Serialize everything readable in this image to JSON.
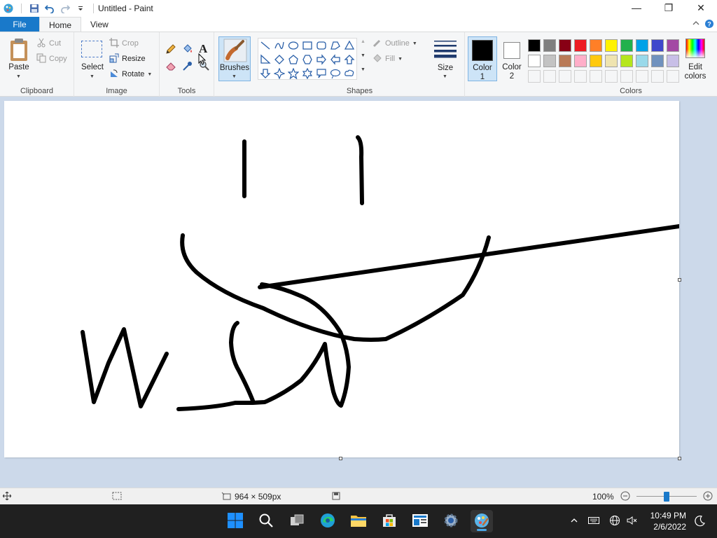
{
  "window": {
    "title": "Untitled - Paint",
    "controls": {
      "minimize": "—",
      "maximize": "❐",
      "close": "✕"
    }
  },
  "tabs": [
    {
      "label": "File"
    },
    {
      "label": "Home"
    },
    {
      "label": "View"
    }
  ],
  "ribbon": {
    "clipboard": {
      "paste": "Paste",
      "cut": "Cut",
      "copy": "Copy",
      "label": "Clipboard"
    },
    "image": {
      "select": "Select",
      "crop": "Crop",
      "resize": "Resize",
      "rotate": "Rotate",
      "label": "Image"
    },
    "tools": {
      "label": "Tools"
    },
    "brushes": {
      "label": "Brushes"
    },
    "shapes": {
      "outline": "Outline",
      "fill": "Fill",
      "label": "Shapes"
    },
    "size": {
      "label": "Size"
    },
    "color1": {
      "line1": "Color",
      "line2": "1",
      "value": "#000000"
    },
    "color2": {
      "line1": "Color",
      "line2": "2",
      "value": "#ffffff"
    },
    "colors": {
      "label": "Colors",
      "edit_line1": "Edit",
      "edit_line2": "colors",
      "palette": [
        "#000000",
        "#7f7f7f",
        "#880015",
        "#ed1c24",
        "#ff7f27",
        "#fff200",
        "#22b14c",
        "#00a2e8",
        "#3f48cc",
        "#a349a4",
        "#ffffff",
        "#c3c3c3",
        "#b97a57",
        "#ffaec9",
        "#ffc90e",
        "#efe4b0",
        "#b5e61d",
        "#99d9ea",
        "#7092be",
        "#c8bfe7",
        "",
        "",
        "",
        "",
        "",
        "",
        "",
        "",
        "",
        ""
      ]
    }
  },
  "status": {
    "canvas_size": "964 × 509px",
    "zoom": "100%",
    "zoom_level": 0.5
  },
  "taskbar": {
    "time": "10:49 PM",
    "date": "2/6/2022"
  }
}
